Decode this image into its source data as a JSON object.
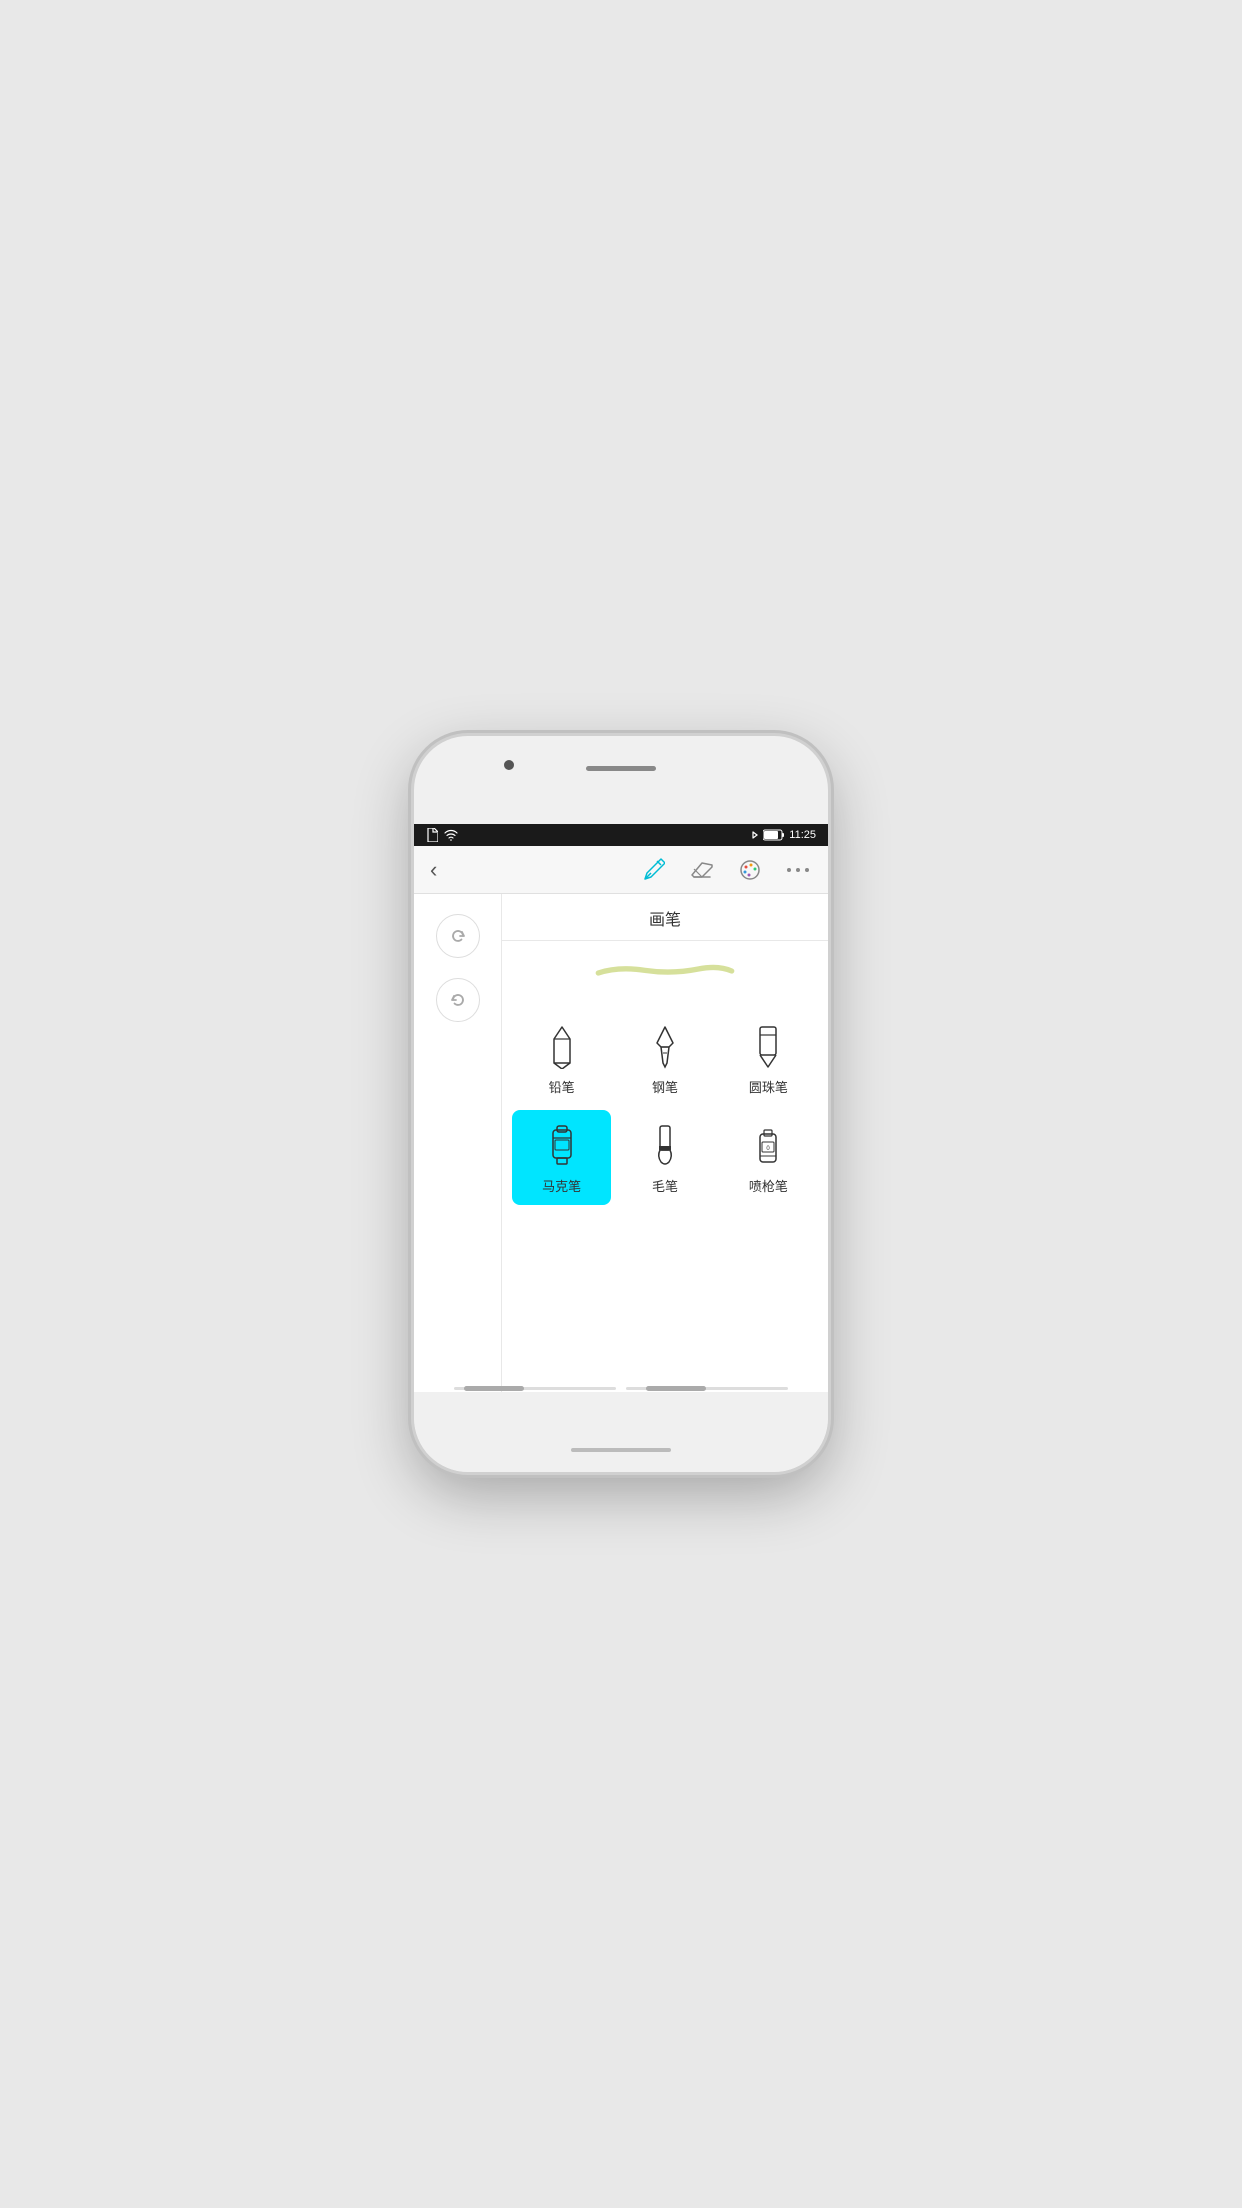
{
  "statusBar": {
    "time": "11:25",
    "icons": {
      "file": "📄",
      "wifi": "wifi",
      "bluetooth": "bluetooth",
      "battery": "battery"
    }
  },
  "toolbar": {
    "backLabel": "‹",
    "brushIconLabel": "brush",
    "eraserIconLabel": "eraser",
    "paletteIconLabel": "palette",
    "moreIconLabel": "more"
  },
  "panelTitle": "画笔",
  "brushes": [
    {
      "id": "pencil",
      "label": "铅笔",
      "active": false
    },
    {
      "id": "fountain-pen",
      "label": "钢笔",
      "active": false
    },
    {
      "id": "ballpoint",
      "label": "圆珠笔",
      "active": false
    },
    {
      "id": "marker",
      "label": "马克笔",
      "active": true
    },
    {
      "id": "brush",
      "label": "毛笔",
      "active": false
    },
    {
      "id": "spray",
      "label": "喷枪笔",
      "active": false
    }
  ],
  "sidebar": {
    "redoLabel": "redo",
    "undoLabel": "undo"
  },
  "colors": {
    "activeBrushBg": "#00e5ff",
    "strokeColor": "#c8d67a"
  }
}
